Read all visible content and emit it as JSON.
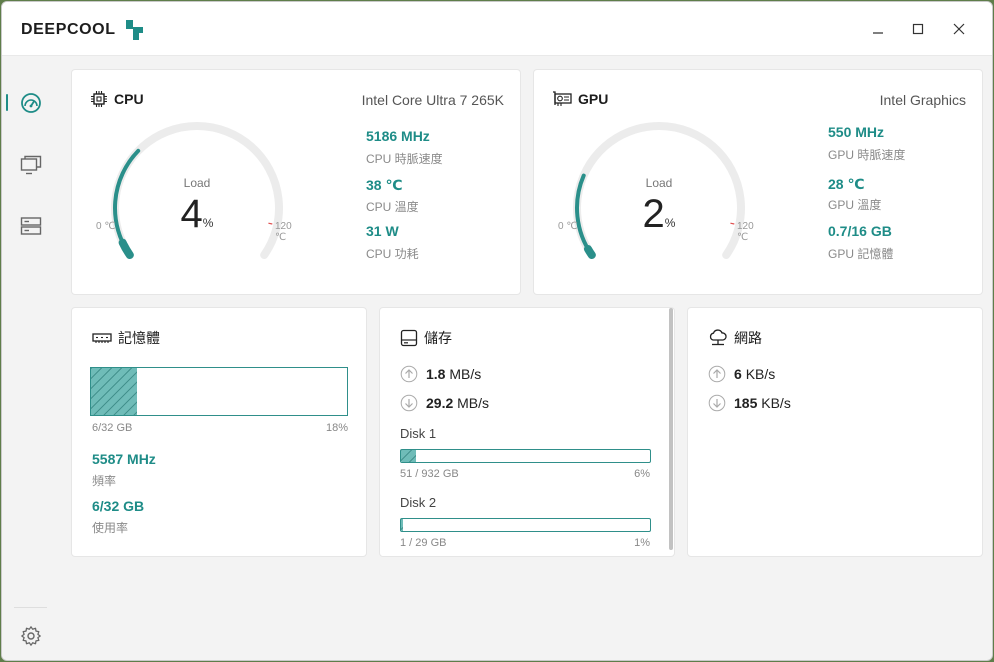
{
  "app": {
    "brand": "DEEPCOOL",
    "accent": "#1e8c87"
  },
  "window_controls": {
    "minimize": "minimize-icon",
    "maximize": "maximize-icon",
    "close": "close-icon"
  },
  "sidebar": {
    "items": [
      {
        "name": "dashboard",
        "icon": "speedometer-icon",
        "active": true
      },
      {
        "name": "display",
        "icon": "monitor-icon",
        "active": false
      },
      {
        "name": "devices",
        "icon": "server-icon",
        "active": false
      }
    ],
    "settings_icon": "gear-icon"
  },
  "cpu": {
    "title": "CPU",
    "model": "Intel Core Ultra 7 265K",
    "load_label": "Load",
    "load_value": "4",
    "load_unit": "%",
    "load_fraction": 0.04,
    "range_min": "0 ℃",
    "range_max": "120 ℃",
    "temp_fraction": 0.3167,
    "stats": [
      {
        "value": "5186 MHz",
        "label": "CPU 時脈速度"
      },
      {
        "value": "38 ℃",
        "label": "CPU 溫度"
      },
      {
        "value": "31 W",
        "label": "CPU 功耗"
      }
    ]
  },
  "gpu": {
    "title": "GPU",
    "model": "Intel Graphics",
    "load_label": "Load",
    "load_value": "2",
    "load_unit": "%",
    "load_fraction": 0.02,
    "range_min": "0 ℃",
    "range_max": "120 ℃",
    "temp_fraction": 0.2333,
    "stats": [
      {
        "value": "550 MHz",
        "label": "GPU 時脈速度"
      },
      {
        "value": "28 ℃",
        "label": "GPU 溫度"
      },
      {
        "value": "0.7/16 GB",
        "label": "GPU 記憶體"
      }
    ]
  },
  "memory": {
    "title": "記憶體",
    "usage_text": "6/32 GB",
    "usage_percent": "18%",
    "usage_fraction": 0.18,
    "stats": [
      {
        "value": "5587 MHz",
        "label": "頻率"
      },
      {
        "value": "6/32 GB",
        "label": "使用率"
      }
    ]
  },
  "storage": {
    "title": "儲存",
    "upload": {
      "value": "1.8",
      "unit": "MB/s"
    },
    "download": {
      "value": "29.2",
      "unit": "MB/s"
    },
    "disks": [
      {
        "name": "Disk 1",
        "usage": "51 / 932 GB",
        "percent": "6%",
        "fraction": 0.06
      },
      {
        "name": "Disk 2",
        "usage": "1 / 29 GB",
        "percent": "1%",
        "fraction": 0.01
      }
    ]
  },
  "network": {
    "title": "網路",
    "upload": {
      "value": "6",
      "unit": "KB/s"
    },
    "download": {
      "value": "185",
      "unit": "KB/s"
    }
  }
}
